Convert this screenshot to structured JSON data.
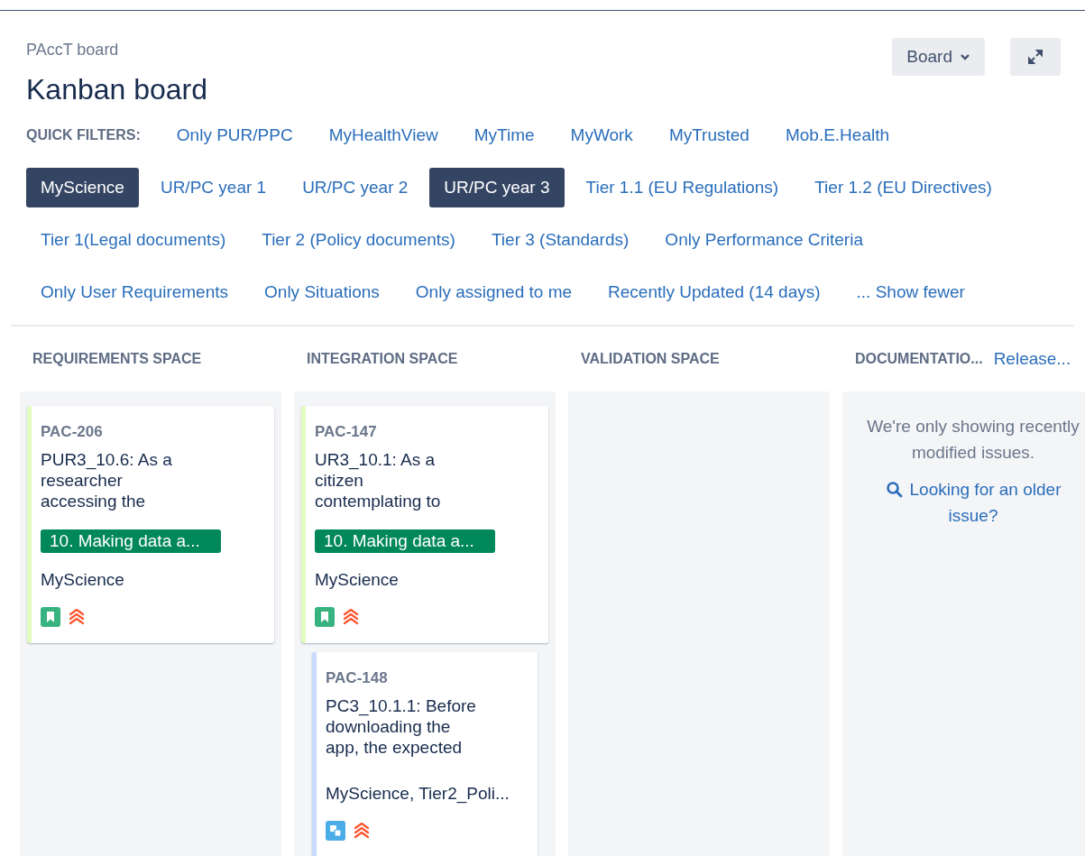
{
  "header": {
    "breadcrumb": "PAccT board",
    "title": "Kanban board",
    "board_menu": "Board"
  },
  "quick_filters": {
    "label": "QUICK FILTERS:",
    "filters": [
      {
        "label": "Only PUR/PPC",
        "selected": false
      },
      {
        "label": "MyHealthView",
        "selected": false
      },
      {
        "label": "MyTime",
        "selected": false
      },
      {
        "label": "MyWork",
        "selected": false
      },
      {
        "label": "MyTrusted",
        "selected": false
      },
      {
        "label": "Mob.E.Health",
        "selected": false
      },
      {
        "label": "MyScience",
        "selected": true
      },
      {
        "label": "UR/PC year 1",
        "selected": false
      },
      {
        "label": "UR/PC year 2",
        "selected": false
      },
      {
        "label": "UR/PC year 3",
        "selected": true
      },
      {
        "label": "Tier 1.1 (EU Regulations)",
        "selected": false
      },
      {
        "label": "Tier 1.2 (EU Directives)",
        "selected": false
      },
      {
        "label": "Tier 1(Legal documents)",
        "selected": false
      },
      {
        "label": "Tier 2 (Policy documents)",
        "selected": false
      },
      {
        "label": "Tier 3 (Standards)",
        "selected": false
      },
      {
        "label": "Only Performance Criteria",
        "selected": false
      },
      {
        "label": "Only User Requirements",
        "selected": false
      },
      {
        "label": "Only Situations",
        "selected": false
      },
      {
        "label": "Only assigned to me",
        "selected": false
      },
      {
        "label": "Recently Updated (14 days)",
        "selected": false
      },
      {
        "label": "... Show fewer",
        "selected": false
      }
    ]
  },
  "columns": [
    {
      "title": "REQUIREMENTS SPACE",
      "cards": [
        {
          "kind": "story",
          "key": "PAC-206",
          "summary": "PUR3_10.6: As a researcher accessing the",
          "epic": "10. Making data a...",
          "labels": "MyScience"
        }
      ]
    },
    {
      "title": "INTEGRATION SPACE",
      "cards": [
        {
          "kind": "story",
          "key": "PAC-147",
          "summary": "UR3_10.1: As a citizen contemplating to",
          "epic": "10. Making data a...",
          "labels": "MyScience"
        },
        {
          "kind": "subtask",
          "key": "PAC-148",
          "summary": "PC3_10.1.1: Before downloading the app, the expected",
          "labels": "MyScience, Tier2_Poli..."
        }
      ]
    },
    {
      "title": "VALIDATION SPACE"
    },
    {
      "title": "DOCUMENTATIO...",
      "link": "Release...",
      "notice": {
        "text": "We're only showing recently modified issues.",
        "link": "Looking for an older issue?"
      }
    }
  ]
}
